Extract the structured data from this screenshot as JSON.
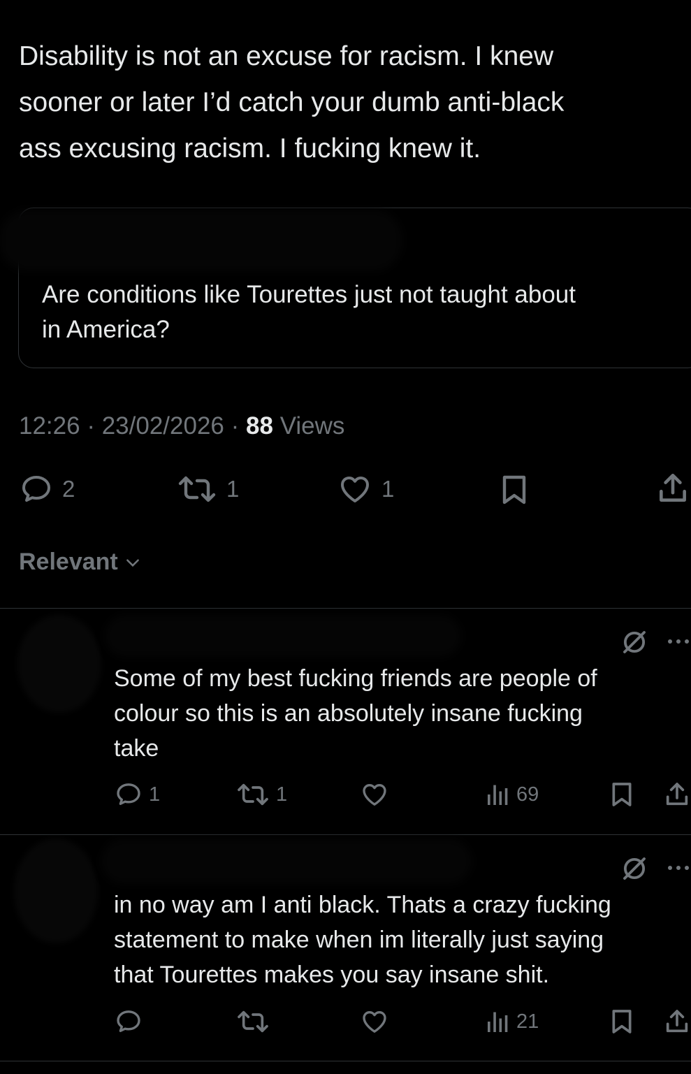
{
  "tweet": {
    "text_lines": [
      "Disability is not an excuse for racism. I knew",
      "sooner or later I’d catch your dumb anti-black",
      "ass excusing racism. I fucking knew it."
    ],
    "quote_lines": [
      "Are conditions like Tourettes just not taught about",
      "in America?"
    ],
    "time": "12:26",
    "date": "23/02/2026",
    "views_count": "88",
    "views_label": "Views",
    "replies": "2",
    "reposts": "1",
    "likes": "1"
  },
  "sort": {
    "label": "Relevant"
  },
  "replies": [
    {
      "text_lines": [
        "Some of my best fucking friends are people of",
        "colour so this is an absolutely insane fucking",
        "take"
      ],
      "replies": "1",
      "reposts": "1",
      "likes": "",
      "views": "69"
    },
    {
      "text_lines": [
        "in no way am I anti black. Thats a crazy fucking",
        "statement to make when im literally just saying",
        "that Tourettes makes you say insane shit."
      ],
      "replies": "",
      "reposts": "",
      "likes": "",
      "views": "21"
    }
  ],
  "colors": {
    "background": "#000000",
    "text": "#e7e9ea",
    "muted": "#71767b",
    "divider": "#2f3336"
  },
  "icons": [
    "reply-icon",
    "repost-icon",
    "like-icon",
    "bookmark-icon",
    "share-icon",
    "views-icon",
    "grok-icon",
    "more-icon",
    "chevron-down-icon"
  ]
}
